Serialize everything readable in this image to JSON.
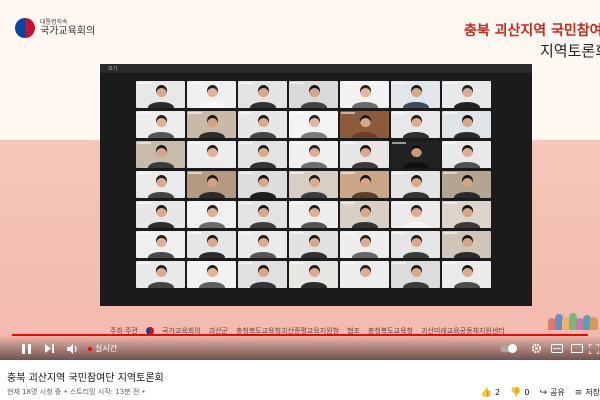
{
  "slide": {
    "logo_sub": "대통령직속",
    "logo_main": "국가교육회의",
    "title_line1": "충북 괴산지역 국민참여",
    "title_line2": "지역토론회",
    "footer_items": [
      "주최·주관",
      "국가교육회의",
      "괴산군",
      "충청북도교육청괴산증평교육지원청",
      "협조",
      "충청북도교육청",
      "괴산미래교육공동체지원센터"
    ]
  },
  "meeting": {
    "window_label": "보기",
    "tiles": [
      {
        "bg": "#e8e8e8",
        "skin": "#d9a98c",
        "cloth": "#2b2b2b",
        "hair": "#1a1a1a"
      },
      {
        "bg": "#f0f0f0",
        "skin": "#e2b496",
        "cloth": "#fafafa",
        "hair": "#222"
      },
      {
        "bg": "#e4e4e4",
        "skin": "#d8a78a",
        "cloth": "#333",
        "hair": "#1c1c1c"
      },
      {
        "bg": "#dadada",
        "skin": "#d6a385",
        "cloth": "#444",
        "hair": "#111"
      },
      {
        "bg": "#f2f2f2",
        "skin": "#e3b59a",
        "cloth": "#6a6a6a",
        "hair": "#222"
      },
      {
        "bg": "#e0e6ec",
        "skin": "#d9a88b",
        "cloth": "#3c4a5c",
        "hair": "#1a1a1a"
      },
      {
        "bg": "#e9e9e9",
        "skin": "#dcab8f",
        "cloth": "#222",
        "hair": "#202020"
      },
      {
        "bg": "#eeeeee",
        "skin": "#e0b194",
        "cloth": "#555",
        "hair": "#222"
      },
      {
        "bg": "#c9b9a8",
        "skin": "#d3a080",
        "cloth": "#2e2e2e",
        "hair": "#161616"
      },
      {
        "bg": "#e7e7e7",
        "skin": "#dba98c",
        "cloth": "#444",
        "hair": "#1d1d1d"
      },
      {
        "bg": "#f3f3f3",
        "skin": "#e4b69b",
        "cloth": "#7a7a7a",
        "hair": "#252525"
      },
      {
        "bg": "#8a5a3a",
        "skin": "#d7a588",
        "cloth": "#6b3f2a",
        "hair": "#191919"
      },
      {
        "bg": "#e8e8e8",
        "skin": "#dcac90",
        "cloth": "#303030",
        "hair": "#1f1f1f"
      },
      {
        "bg": "#dfe4e8",
        "skin": "#d8a689",
        "cloth": "#2a2a2a",
        "hair": "#151515"
      },
      {
        "bg": "#c7bba9",
        "skin": "#d6a486",
        "cloth": "#3a3a3a",
        "hair": "#1a1a1a"
      },
      {
        "bg": "#ececec",
        "skin": "#e1b296",
        "cloth": "#eaeaea",
        "hair": "#222"
      },
      {
        "bg": "#e3e3e3",
        "skin": "#daa98c",
        "cloth": "#333",
        "hair": "#1b1b1b"
      },
      {
        "bg": "#f0f0f0",
        "skin": "#dfae92",
        "cloth": "#6d6d6d",
        "hair": "#202020"
      },
      {
        "bg": "#e6e6e6",
        "skin": "#d9a88b",
        "cloth": "#3a3a3a",
        "hair": "#121212"
      },
      {
        "bg": "#222222",
        "skin": "#c99a7e",
        "cloth": "#111",
        "hair": "#0c0c0c"
      },
      {
        "bg": "#e9e9e9",
        "skin": "#ddad91",
        "cloth": "#505050",
        "hair": "#1d1d1d"
      },
      {
        "bg": "#eaeaea",
        "skin": "#dbaa8d",
        "cloth": "#444",
        "hair": "#1b1b1b"
      },
      {
        "bg": "#b59a82",
        "skin": "#d4a083",
        "cloth": "#2c2c2c",
        "hair": "#161616"
      },
      {
        "bg": "#dddddd",
        "skin": "#d8a78a",
        "cloth": "#1e1e1e",
        "hair": "#111"
      },
      {
        "bg": "#d7cfc4",
        "skin": "#dba98c",
        "cloth": "#3b3b3b",
        "hair": "#1a1a1a"
      },
      {
        "bg": "#c9a788",
        "skin": "#d6a487",
        "cloth": "#5a3c2a",
        "hair": "#171717"
      },
      {
        "bg": "#e4e4e4",
        "skin": "#daa98c",
        "cloth": "#343434",
        "hair": "#1a1a1a"
      },
      {
        "bg": "#b3a591",
        "skin": "#d5a285",
        "cloth": "#2a2a2a",
        "hair": "#141414"
      },
      {
        "bg": "#e7e7e7",
        "skin": "#dcab8f",
        "cloth": "#2e2e2e",
        "hair": "#1c1c1c"
      },
      {
        "bg": "#f1f1f1",
        "skin": "#e0b094",
        "cloth": "#6b6b6b",
        "hair": "#222"
      },
      {
        "bg": "#e3e3e3",
        "skin": "#d9a88a",
        "cloth": "#3d3d3d",
        "hair": "#181818"
      },
      {
        "bg": "#ededed",
        "skin": "#dfae92",
        "cloth": "#555",
        "hair": "#1f1f1f"
      },
      {
        "bg": "#d8d0c6",
        "skin": "#d8a78a",
        "cloth": "#333",
        "hair": "#181818"
      },
      {
        "bg": "#ecebea",
        "skin": "#ddac90",
        "cloth": "#f5f5f5",
        "hair": "#202020"
      },
      {
        "bg": "#dcd4ca",
        "skin": "#d7a588",
        "cloth": "#3a3a3a",
        "hair": "#151515"
      },
      {
        "bg": "#f0f0f0",
        "skin": "#e1b296",
        "cloth": "#4a4a4a",
        "hair": "#202020"
      },
      {
        "bg": "#e6e6e6",
        "skin": "#daa98c",
        "cloth": "#2d2d2d",
        "hair": "#1a1a1a"
      },
      {
        "bg": "#ebebeb",
        "skin": "#dcab8f",
        "cloth": "#555",
        "hair": "#1d1d1d"
      },
      {
        "bg": "#e2e2e2",
        "skin": "#d9a88b",
        "cloth": "#303030",
        "hair": "#171717"
      },
      {
        "bg": "#eeeeee",
        "skin": "#dfae92",
        "cloth": "#666",
        "hair": "#202020"
      },
      {
        "bg": "#e5e5e5",
        "skin": "#daa98c",
        "cloth": "#3a3a3a",
        "hair": "#1b1b1b"
      },
      {
        "bg": "#cfc5b9",
        "skin": "#d6a487",
        "cloth": "#2a2a2a",
        "hair": "#151515"
      },
      {
        "bg": "#e9e9e9",
        "skin": "#dcab8f",
        "cloth": "#444",
        "hair": "#1b1b1b"
      },
      {
        "bg": "#f2f2f2",
        "skin": "#e2b397",
        "cloth": "#5e5e5e",
        "hair": "#222"
      },
      {
        "bg": "#e0e0e0",
        "skin": "#d8a78a",
        "cloth": "#333",
        "hair": "#161616"
      },
      {
        "bg": "#e8e6e3",
        "skin": "#dcab8f",
        "cloth": "#2b2b2b",
        "hair": "#1a1a1a"
      },
      {
        "bg": "#eeeeee",
        "skin": "#dfae92",
        "cloth": "#eeeeee",
        "hair": "#1f1f1f"
      },
      {
        "bg": "#dcdcdc",
        "skin": "#d9a88b",
        "cloth": "#3b3b3b",
        "hair": "#181818"
      },
      {
        "bg": "#ebebeb",
        "skin": "#ddac90",
        "cloth": "#4c4c4c",
        "hair": "#1e1e1e"
      }
    ]
  },
  "player": {
    "live_label": "실시간",
    "progress": 1.0,
    "accent_color": "#ff0000",
    "icons": [
      "pause-icon",
      "next-icon",
      "volume-icon",
      "autoplay-toggle",
      "settings-icon",
      "subtitles-icon",
      "theater-icon",
      "fullscreen-icon"
    ]
  },
  "video": {
    "title": "충북 괴산지역 국민참여단 지역토론회",
    "meta": "현재 18명 시청 중 • 스트리밍 시작: 13분 전 •",
    "like_count": "2",
    "dislike_count": "0",
    "share_label": "공유",
    "save_label": "저장"
  }
}
